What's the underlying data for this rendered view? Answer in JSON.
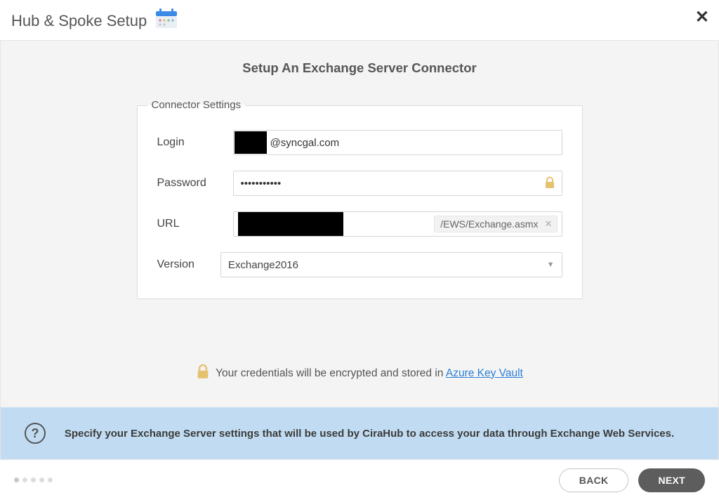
{
  "header": {
    "title": "Hub & Spoke Setup"
  },
  "page": {
    "title": "Setup An Exchange Server Connector"
  },
  "fieldset": {
    "legend": "Connector Settings",
    "login": {
      "label": "Login",
      "value": "@syncgal.com"
    },
    "password": {
      "label": "Password",
      "value": "•••••••••••"
    },
    "url": {
      "label": "URL",
      "suffix": "/EWS/Exchange.asmx"
    },
    "version": {
      "label": "Version",
      "value": "Exchange2016"
    }
  },
  "encrypt_note": {
    "prefix": "Your credentials will be encrypted and stored in ",
    "link": "Azure Key Vault"
  },
  "info": {
    "text": "Specify your Exchange Server settings that will be used by CiraHub to access your data through Exchange Web Services."
  },
  "footer": {
    "back": "BACK",
    "next": "NEXT"
  }
}
